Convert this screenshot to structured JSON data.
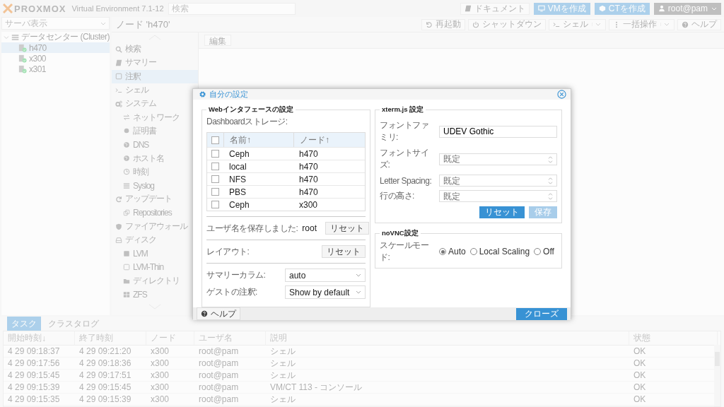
{
  "header": {
    "logo": "PROXMOX",
    "product": "Virtual Environment 7.1-12",
    "search": {
      "placeholder": "検索"
    },
    "buttons": [
      {
        "label": "ドキュメント",
        "kind": "plain"
      },
      {
        "label": "VMを作成",
        "kind": "primary"
      },
      {
        "label": "CTを作成",
        "kind": "primary"
      },
      {
        "label": "root@pam",
        "kind": "user"
      }
    ]
  },
  "tree": {
    "view": "サーバ表示",
    "items": [
      {
        "label": "データセンター (Cluster)",
        "expanded": true,
        "selected": false,
        "children": [
          {
            "label": "h470",
            "selected": true
          },
          {
            "label": "x300",
            "selected": false
          },
          {
            "label": "x301",
            "selected": false
          }
        ]
      }
    ]
  },
  "node": {
    "title": "ノード 'h470'",
    "buttons": [
      {
        "label": "再起動",
        "kind": "plain"
      },
      {
        "label": "シャットダウン",
        "kind": "plain"
      },
      {
        "label": "シェル",
        "kind": "split"
      },
      {
        "label": "一括操作",
        "kind": "split"
      },
      {
        "label": "ヘルプ",
        "kind": "plain"
      }
    ],
    "nav": [
      {
        "label": "検索",
        "selected": false
      },
      {
        "label": "サマリー",
        "selected": false
      },
      {
        "label": "注釈",
        "selected": true
      },
      {
        "label": "シェル",
        "selected": false
      },
      {
        "label": "システム",
        "selected": false,
        "children": [
          {
            "label": "ネットワーク",
            "selected": false
          },
          {
            "label": "証明書",
            "selected": false
          },
          {
            "label": "DNS",
            "selected": false
          },
          {
            "label": "ホスト名",
            "selected": false
          },
          {
            "label": "時刻",
            "selected": false
          },
          {
            "label": "Syslog",
            "selected": false
          }
        ]
      },
      {
        "label": "アップデート",
        "selected": false,
        "children": [
          {
            "label": "Repositories",
            "selected": false
          }
        ]
      },
      {
        "label": "ファイアウォール",
        "selected": false
      },
      {
        "label": "ディスク",
        "selected": false,
        "children": [
          {
            "label": "LVM",
            "selected": false
          },
          {
            "label": "LVM-Thin",
            "selected": false
          },
          {
            "label": "ディレクトリ",
            "selected": false
          },
          {
            "label": "ZFS",
            "selected": false
          }
        ]
      }
    ],
    "toolbar": [
      "編集"
    ]
  },
  "tasks": {
    "tabs": [
      {
        "label": "タスク",
        "selected": true
      },
      {
        "label": "クラスタログ",
        "selected": false
      }
    ],
    "columns": [
      {
        "label": "開始時刻",
        "sort": "↓"
      },
      {
        "label": "終了時刻"
      },
      {
        "label": "ノード"
      },
      {
        "label": "ユーザ名"
      },
      {
        "label": "説明"
      },
      {
        "label": "状態"
      }
    ],
    "rows": [
      [
        "4 29 09:18:37",
        "4 29 09:21:20",
        "x300",
        "root@pam",
        "シェル",
        "OK"
      ],
      [
        "4 29 09:17:56",
        "4 29 09:18:36",
        "x300",
        "root@pam",
        "シェル",
        "OK"
      ],
      [
        "4 29 09:15:45",
        "4 29 09:17:51",
        "x300",
        "root@pam",
        "シェル",
        "OK"
      ],
      [
        "4 29 09:15:39",
        "4 29 09:15:45",
        "x300",
        "root@pam",
        "VM/CT 113 - コンソール",
        "OK"
      ],
      [
        "4 29 09:15:35",
        "4 29 09:15:39",
        "x300",
        "root@pam",
        "シェル",
        "OK"
      ]
    ]
  },
  "dialog": {
    "title": "自分の設定",
    "web": {
      "legend": "Webインタフェースの設定",
      "storage_label": "Dashboardストレージ:",
      "all_checked": false,
      "columns": [
        {
          "label": "名前",
          "sort": "↑"
        },
        {
          "label": "ノード",
          "sort": "↑"
        }
      ],
      "rows": [
        {
          "name": "Ceph",
          "node": "h470",
          "checked": false
        },
        {
          "name": "local",
          "node": "h470",
          "checked": false
        },
        {
          "name": "NFS",
          "node": "h470",
          "checked": false
        },
        {
          "name": "PBS",
          "node": "h470",
          "checked": false
        },
        {
          "name": "Ceph",
          "node": "x300",
          "checked": false
        }
      ],
      "saved_user": {
        "label": "ユーザ名を保存しました:",
        "value": "root",
        "button": "リセット"
      },
      "layout": {
        "label": "レイアウト:",
        "button": "リセット"
      },
      "selects": [
        {
          "label": "サマリーカラム:",
          "value": "auto"
        },
        {
          "label": "ゲストの注釈:",
          "value": "Show by default"
        }
      ]
    },
    "xterm": {
      "legend": "xterm.js 設定",
      "fields": [
        {
          "label": "フォントファミリ:",
          "kind": "text",
          "value": "UDEV Gothic"
        },
        {
          "label": "フォントサイズ:",
          "kind": "spinner",
          "placeholder": "既定"
        },
        {
          "label": "Letter Spacing:",
          "kind": "spinner",
          "placeholder": "既定"
        },
        {
          "label": "行の高さ:",
          "kind": "spinner",
          "placeholder": "既定"
        }
      ],
      "buttons": [
        {
          "label": "リセット",
          "disabled": false
        },
        {
          "label": "保存",
          "disabled": true
        }
      ]
    },
    "novnc": {
      "legend": "noVNC設定",
      "label": "スケールモード:",
      "options": [
        {
          "label": "Auto",
          "selected": true
        },
        {
          "label": "Local Scaling",
          "selected": false
        },
        {
          "label": "Off",
          "selected": false
        }
      ]
    },
    "footer": {
      "help": "ヘルプ",
      "close": "クローズ"
    }
  }
}
